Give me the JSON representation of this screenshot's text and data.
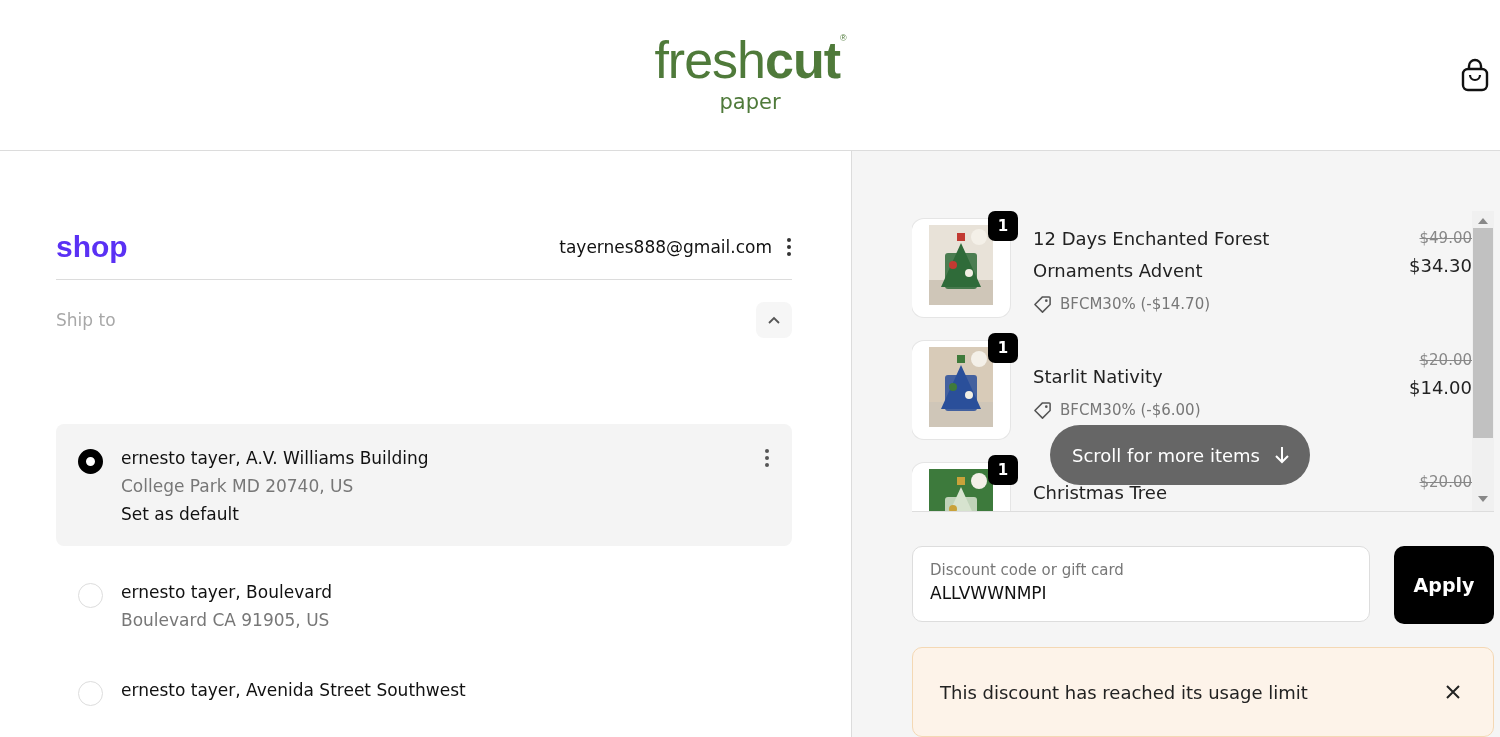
{
  "header": {
    "logo": "fresh**cut**$^{®}$",
    "logo_sub": "paper"
  },
  "account": {
    "brand": "shop",
    "email": "tayernes888@gmail.com"
  },
  "ship_to": {
    "label": "Ship to",
    "expanded": true
  },
  "addresses": [
    {
      "line1": "ernesto tayer, A.V. Williams Building",
      "line2": "College Park MD 20740, US",
      "default_label": "Set as default",
      "selected": true
    },
    {
      "line1": "ernesto tayer, Boulevard",
      "line2": "Boulevard CA 91905, US",
      "selected": false
    },
    {
      "line1": "ernesto tayer, Avenida Street Southwest",
      "selected": false
    }
  ],
  "cart_items": [
    {
      "kind": "picture",
      "quantity": "1",
      "name": "12 Days Enchanted Forest Ornaments Advent",
      "discount": "BFCM30% (-$14.70)",
      "original_price": "$49.00",
      "price": "$34.30"
    },
    {
      "kind": "picture",
      "quantity": "1",
      "name": "Starlit Nativity",
      "discount": "BFCM30% (-$6.00)",
      "original_price": "$20.00",
      "price": "$14.00"
    },
    {
      "kind": "picture",
      "quantity": "1",
      "name": "Christmas Tree",
      "original_price": "$20.00"
    }
  ],
  "scroll_hint": "Scroll for more items",
  "discount_field": {
    "placeholder": "Discount code or gift card",
    "value": "ALLVWWNMPI"
  },
  "apply_button": "Apply",
  "alert": {
    "message": "This discount has reached its usage limit"
  }
}
